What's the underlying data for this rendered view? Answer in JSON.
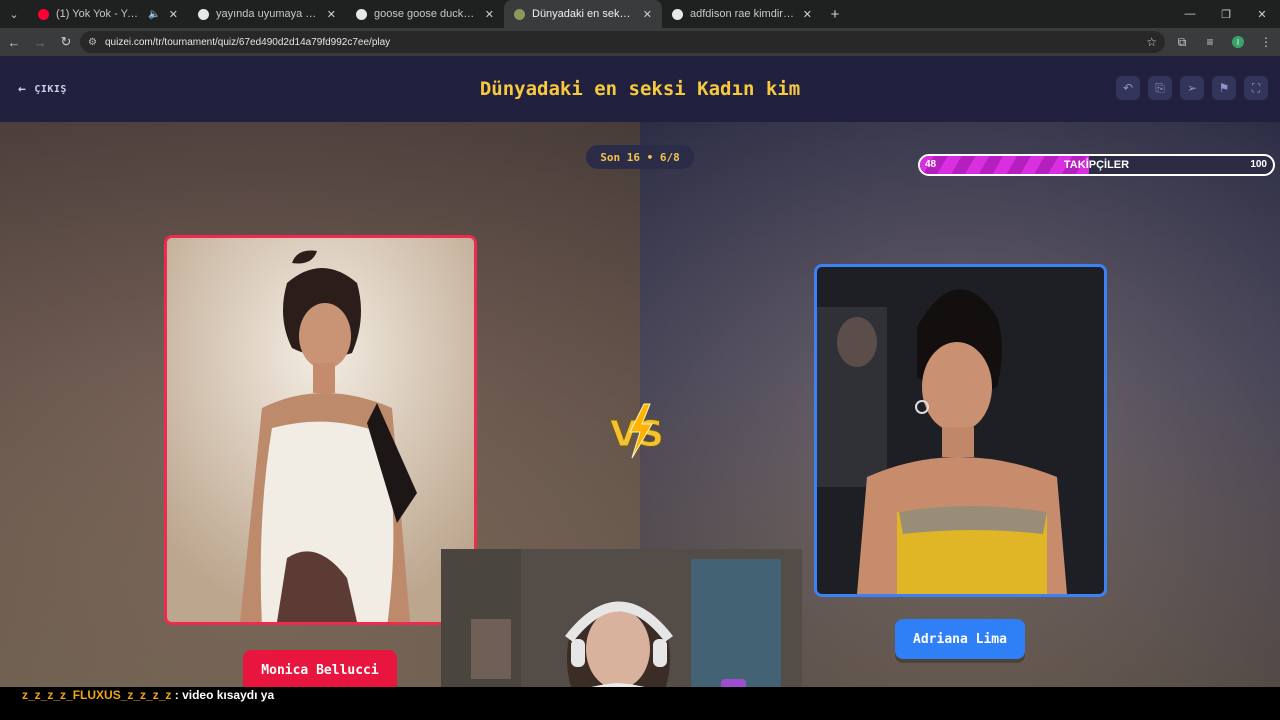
{
  "browser": {
    "tabs": [
      {
        "title": "(1) Yok Yok - YouTube",
        "favicon_color": "#ff0033",
        "audio": true
      },
      {
        "title": "yayında uyumaya çalışan kadın",
        "favicon_color": "#e8e8e8",
        "audio": false
      },
      {
        "title": "goose goose duck oyun nasıl -",
        "favicon_color": "#e8e8e8",
        "audio": false
      },
      {
        "title": "Dünyadaki en seksi Kadın kim -",
        "favicon_color": "#8a9a5b",
        "audio": false,
        "active": true
      },
      {
        "title": "adfdison rae kimdir - Google'da",
        "favicon_color": "#e8e8e8",
        "audio": false
      }
    ],
    "url": "quizei.com/tr/tournament/quiz/67ed490d2d14a79fd992c7ee/play",
    "profile_initial": "I"
  },
  "header": {
    "exit_label": "ÇIKIŞ",
    "title": "Dünyadaki en seksi Kadın kim",
    "tool_icons": [
      "undo-icon",
      "share-icon",
      "send-icon",
      "flag-icon",
      "fullscreen-icon"
    ]
  },
  "round": {
    "label": "Son 16 • 6/8"
  },
  "followers": {
    "label": "TAKİPÇİLER",
    "current": "48",
    "target": "100",
    "progress_fraction": 0.48,
    "fill_color": "#d92fe0"
  },
  "contestants": {
    "left": {
      "name": "Monica Bellucci",
      "accent": "#e8163e"
    },
    "right": {
      "name": "Adriana Lima",
      "accent": "#2f80f7"
    }
  },
  "chat": {
    "user": "z_z_z_z_FLUXUS_z_z_z_z",
    "separator": " : ",
    "message": "video kısaydı ya"
  }
}
